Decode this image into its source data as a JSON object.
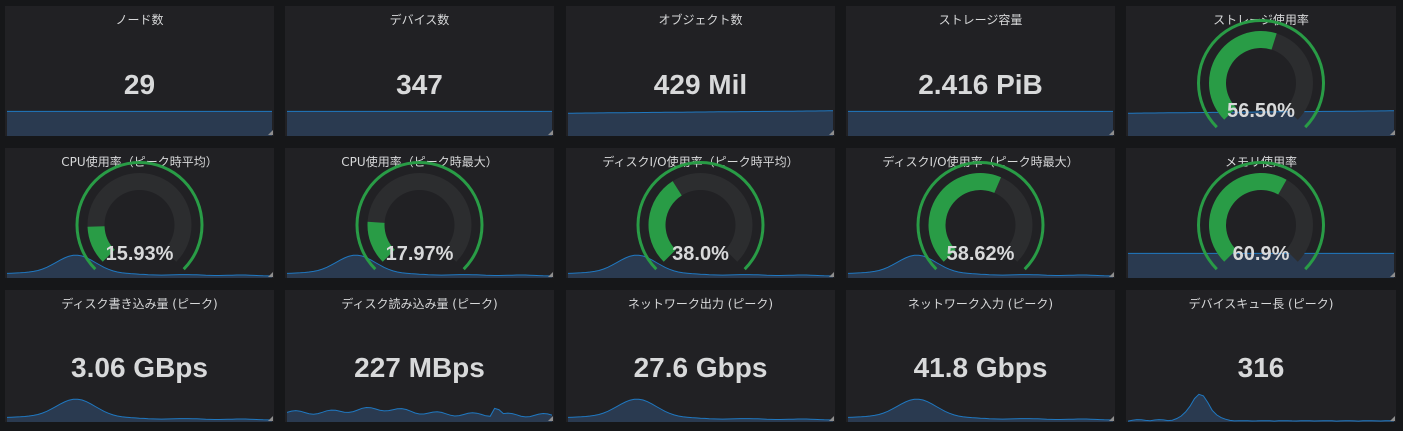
{
  "colors": {
    "background": "#161719",
    "panel": "#212124",
    "text": "#d8d9da",
    "spark_line": "#1f78c1",
    "spark_fill": "#2a3a50",
    "gauge_fill": "#299c46",
    "gauge_outer": "#299c46",
    "gauge_track": "#2c2d2f"
  },
  "panels": [
    {
      "title": "ノード数",
      "value": "29",
      "type": "stat",
      "spark": "flat"
    },
    {
      "title": "デバイス数",
      "value": "347",
      "type": "stat",
      "spark": "flat"
    },
    {
      "title": "オブジェクト数",
      "value": "429 Mil",
      "type": "stat",
      "spark": "rising"
    },
    {
      "title": "ストレージ容量",
      "value": "2.416 PiB",
      "type": "stat",
      "spark": "flat"
    },
    {
      "title": "ストレージ使用率",
      "value": "56.50%",
      "type": "gauge",
      "percent": 56.5,
      "spark": "rising"
    },
    {
      "title": "CPU使用率（ピーク時平均）",
      "value": "15.93%",
      "type": "gauge",
      "percent": 15.93,
      "spark": "hump"
    },
    {
      "title": "CPU使用率（ピーク時最大）",
      "value": "17.97%",
      "type": "gauge",
      "percent": 17.97,
      "spark": "hump"
    },
    {
      "title": "ディスクI/O使用率（ピーク時平均）",
      "value": "38.0%",
      "type": "gauge",
      "percent": 38.0,
      "spark": "hump"
    },
    {
      "title": "ディスクI/O使用率（ピーク時最大）",
      "value": "58.62%",
      "type": "gauge",
      "percent": 58.62,
      "spark": "hump"
    },
    {
      "title": "メモリ使用率",
      "value": "60.9%",
      "type": "gauge",
      "percent": 60.9,
      "spark": "flat"
    },
    {
      "title": "ディスク書き込み量 (ピーク)",
      "value": "3.06 GBps",
      "type": "stat",
      "spark": "hump"
    },
    {
      "title": "ディスク読み込み量 (ピーク)",
      "value": "227 MBps",
      "type": "stat",
      "spark": "noisy"
    },
    {
      "title": "ネットワーク出力 (ピーク)",
      "value": "27.6 Gbps",
      "type": "stat",
      "spark": "hump"
    },
    {
      "title": "ネットワーク入力 (ピーク)",
      "value": "41.8 Gbps",
      "type": "stat",
      "spark": "hump"
    },
    {
      "title": "デバイスキュー長 (ピーク)",
      "value": "316",
      "type": "stat",
      "spark": "spike"
    }
  ]
}
